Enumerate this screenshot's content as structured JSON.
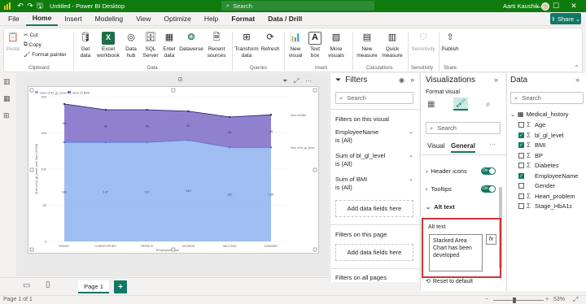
{
  "titlebar": {
    "document_title": "Untitled - Power BI Desktop",
    "search_placeholder": "Search",
    "user_name": "Aarti Kaushik",
    "minimize": "—",
    "maximize": "☐",
    "close": "✕"
  },
  "menu": {
    "items": [
      "File",
      "Home",
      "Insert",
      "Modeling",
      "View",
      "Optimize",
      "Help",
      "Format",
      "Data / Drill"
    ],
    "active": "Home",
    "share_label": "Share"
  },
  "ribbon": {
    "paste": "Paste",
    "cut": "Cut",
    "copy": "Copy",
    "format_painter": "Format painter",
    "clipboard_group": "Clipboard",
    "get_data": "Get data",
    "excel_workbook": "Excel workbook",
    "data_hub": "Data hub",
    "sql_server": "SQL Server",
    "enter_data": "Enter data",
    "dataverse": "Dataverse",
    "recent_sources": "Recent sources",
    "data_group": "Data",
    "transform_data": "Transform data",
    "refresh": "Refresh",
    "queries_group": "Queries",
    "new_visual": "New visual",
    "text_box": "Text box",
    "more_visuals": "More visuals",
    "insert_group": "Insert",
    "new_measure": "New measure",
    "quick_measure": "Quick measure",
    "calculations_group": "Calculations",
    "sensitivity": "Sensitivity",
    "sensitivity_group": "Sensitivity",
    "publish": "Publish",
    "share_group": "Share"
  },
  "chart_data": {
    "type": "area",
    "stacked": true,
    "categories": [
      "WENDY",
      "CHRISTOPHER",
      "PATRICK",
      "GEORGE",
      "WILFORD",
      "EDWARD"
    ],
    "series": [
      {
        "name": "Sum of bl_gl_level",
        "values": [
          137,
          137,
          137,
          140,
          130,
          130
        ],
        "color": "#8fb1f0"
      },
      {
        "name": "Sum of BMI",
        "values": [
          53,
          45,
          45,
          40,
          42,
          45
        ],
        "color": "#7c6bc6"
      }
    ],
    "data_labels_bottom": [
      "180",
      "137",
      "137",
      "140",
      "130",
      "130"
    ],
    "data_labels_top": [
      "53",
      "45",
      "45",
      "40",
      "42",
      "45"
    ],
    "data_labels_bottom_pos": [
      "137",
      "137",
      "137",
      "140",
      "130",
      "130"
    ],
    "legend": [
      "Sum of bl_gl_level",
      "Sum of BMI"
    ],
    "legend_position": "top-left",
    "ylabel": "Sum of bl_gl_level and Sum of BMI",
    "xlabel": "EmployeeName",
    "ylim": [
      0,
      200
    ],
    "yticks": [
      "200",
      "150",
      "100",
      "50",
      "0"
    ],
    "right_labels": [
      "Sum of BMI",
      "Sum of bl_gl_level"
    ]
  },
  "filters": {
    "title": "Filters",
    "search_placeholder": "Search",
    "on_visual_heading": "Filters on this visual",
    "cards": [
      {
        "name": "EmployeeName",
        "value": "is (All)"
      },
      {
        "name": "Sum of bl_gl_level",
        "value": "is (All)"
      },
      {
        "name": "Sum of BMI",
        "value": "is (All)"
      }
    ],
    "add_fields": "Add data fields here",
    "on_page_heading": "Filters on this page",
    "add_fields_page": "Add data fields here",
    "on_all_pages": "Filters on all pages"
  },
  "visualizations": {
    "title": "Visualizations",
    "subtitle": "Format visual",
    "search_placeholder": "Search",
    "tab_visual": "Visual",
    "tab_general": "General",
    "more": "···",
    "header_icons": "Header icons",
    "tooltips": "Tooltips",
    "alt_text_section": "Alt text",
    "alt_text_label": "Alt text",
    "alt_text_value": "Stacked Area Chart has been developed",
    "toggle_on": "On",
    "fx": "fx",
    "reset": "Reset to default"
  },
  "data": {
    "title": "Data",
    "search_placeholder": "Search",
    "table_name": "Medical_history",
    "fields": [
      {
        "name": "Age",
        "sigma": true,
        "checked": false
      },
      {
        "name": "bl_gl_level",
        "sigma": true,
        "checked": true
      },
      {
        "name": "BMI",
        "sigma": true,
        "checked": true
      },
      {
        "name": "BP",
        "sigma": true,
        "checked": false
      },
      {
        "name": "Diabetes",
        "sigma": true,
        "checked": false
      },
      {
        "name": "EmployeeName",
        "sigma": false,
        "checked": true
      },
      {
        "name": "Gender",
        "sigma": false,
        "checked": false
      },
      {
        "name": "Heart_problem",
        "sigma": true,
        "checked": false
      },
      {
        "name": "Stage_HbA1c",
        "sigma": true,
        "checked": false
      }
    ]
  },
  "pages": {
    "tabs": [
      "Page 1"
    ],
    "add": "+"
  },
  "status": {
    "page_info": "Page 1 of 1",
    "zoom": "53%"
  }
}
